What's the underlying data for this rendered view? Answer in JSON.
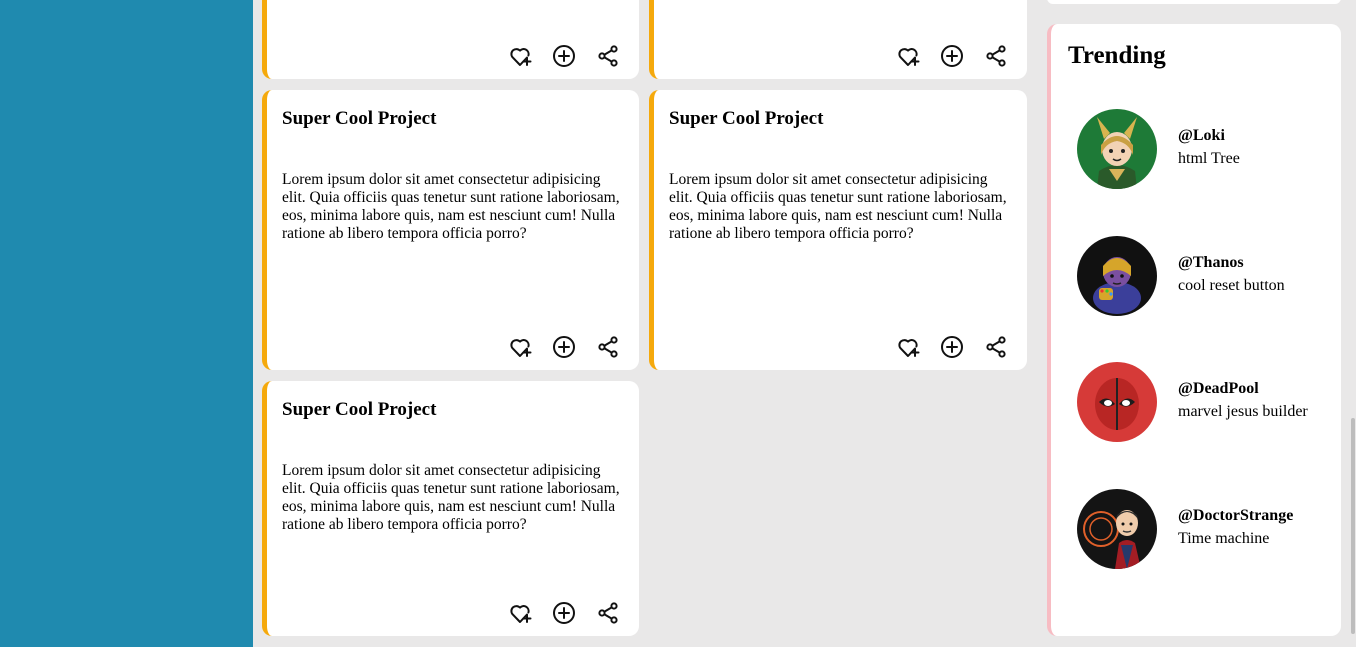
{
  "cards": [
    {
      "title": "",
      "body": ""
    },
    {
      "title": "",
      "body": ""
    },
    {
      "title": "Super Cool Project",
      "body": "Lorem ipsum dolor sit amet consectetur adipisicing elit. Quia officiis quas tenetur sunt ratione laboriosam, eos, minima labore quis, nam est nesciunt cum! Nulla ratione ab libero tempora officia porro?"
    },
    {
      "title": "Super Cool Project",
      "body": "Lorem ipsum dolor sit amet consectetur adipisicing elit. Quia officiis quas tenetur sunt ratione laboriosam, eos, minima labore quis, nam est nesciunt cum! Nulla ratione ab libero tempora officia porro?"
    },
    {
      "title": "Super Cool Project",
      "body": "Lorem ipsum dolor sit amet consectetur adipisicing elit. Quia officiis quas tenetur sunt ratione laboriosam, eos, minima labore quis, nam est nesciunt cum! Nulla ratione ab libero tempora officia porro?"
    }
  ],
  "card_actions": [
    "heart-plus-icon",
    "add-circle-icon",
    "share-icon"
  ],
  "trending": {
    "title": "Trending",
    "items": [
      {
        "handle": "@Loki",
        "project": "html Tree",
        "avatar": "loki-avatar"
      },
      {
        "handle": "@Thanos",
        "project": "cool reset button",
        "avatar": "thanos-avatar"
      },
      {
        "handle": "@DeadPool",
        "project": "marvel jesus builder",
        "avatar": "deadpool-avatar"
      },
      {
        "handle": "@DoctorStrange",
        "project": "Time machine",
        "avatar": "doctorstrange-avatar"
      }
    ]
  },
  "colors": {
    "sidebar": "#1f8aaf",
    "background": "#e9e8e8",
    "card_accent": "#f5a90c",
    "trending_accent": "#f7bcc3"
  }
}
